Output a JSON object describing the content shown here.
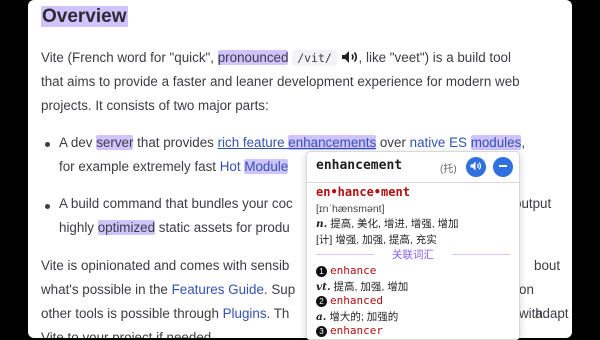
{
  "heading": "Overview",
  "intro": {
    "p1": "Vite (French word for \"quick\", ",
    "hl1": "pronounced",
    "code": "/vit/",
    "p2": ", like \"veet\") is a build tool",
    "line2": "that aims to provide a faster and leaner development experience for modern web",
    "line3": "projects. It consists of two major parts:"
  },
  "bullet1": {
    "t1": "A dev ",
    "hl_server": "server",
    "t2": " that provides ",
    "link1a": "rich feature ",
    "link1b": "enhancements",
    "t3": " over ",
    "link2a": "native ES ",
    "link2b": "modules",
    "t4": ",",
    "line2a": "for example extremely fast ",
    "link3a": "Hot ",
    "link3b": "Module"
  },
  "bullet2": {
    "line1a": "A build command that bundles your coc",
    "line1b": "output",
    "line2a": "highly ",
    "hl_opt": "optimized",
    "line2b": " static assets for produ"
  },
  "outro": {
    "l1a": "Vite is opinionated and comes with sensib",
    "l1b": "bout",
    "l2a": "what's possible in the ",
    "l2link": "Features Guide",
    "l2b": ". Sup",
    "l2c": "on with",
    "l3a": "other tools is possible through ",
    "l3link": "Plugins",
    "l3b": ". Th",
    "l3c": "adapt",
    "l4": "Vite to your project if needed."
  },
  "popup": {
    "word": "enhancement",
    "tag": "(托)",
    "syllables": "en•hance•ment",
    "phonetic": "[ɪnˈhænsmənt]",
    "defs": [
      {
        "pos": "n.",
        "text": "提高, 美化, 增进, 增强, 增加"
      },
      {
        "pos": "[计]",
        "text": "增强, 加强, 提高, 充实"
      }
    ],
    "section_title": "关联词汇",
    "related": [
      {
        "num": "1",
        "word": "enhance",
        "pos": "vt.",
        "meaning": "提高, 加强, 增加"
      },
      {
        "num": "2",
        "word": "enhanced",
        "pos": "a.",
        "meaning": "增大的; 加强的"
      },
      {
        "num": "3",
        "word": "enhancer"
      }
    ]
  },
  "colors": {
    "highlight": "#cfc4ff",
    "link": "#3451b2",
    "accent": "#2f6fe0",
    "word_red": "#b11010"
  }
}
